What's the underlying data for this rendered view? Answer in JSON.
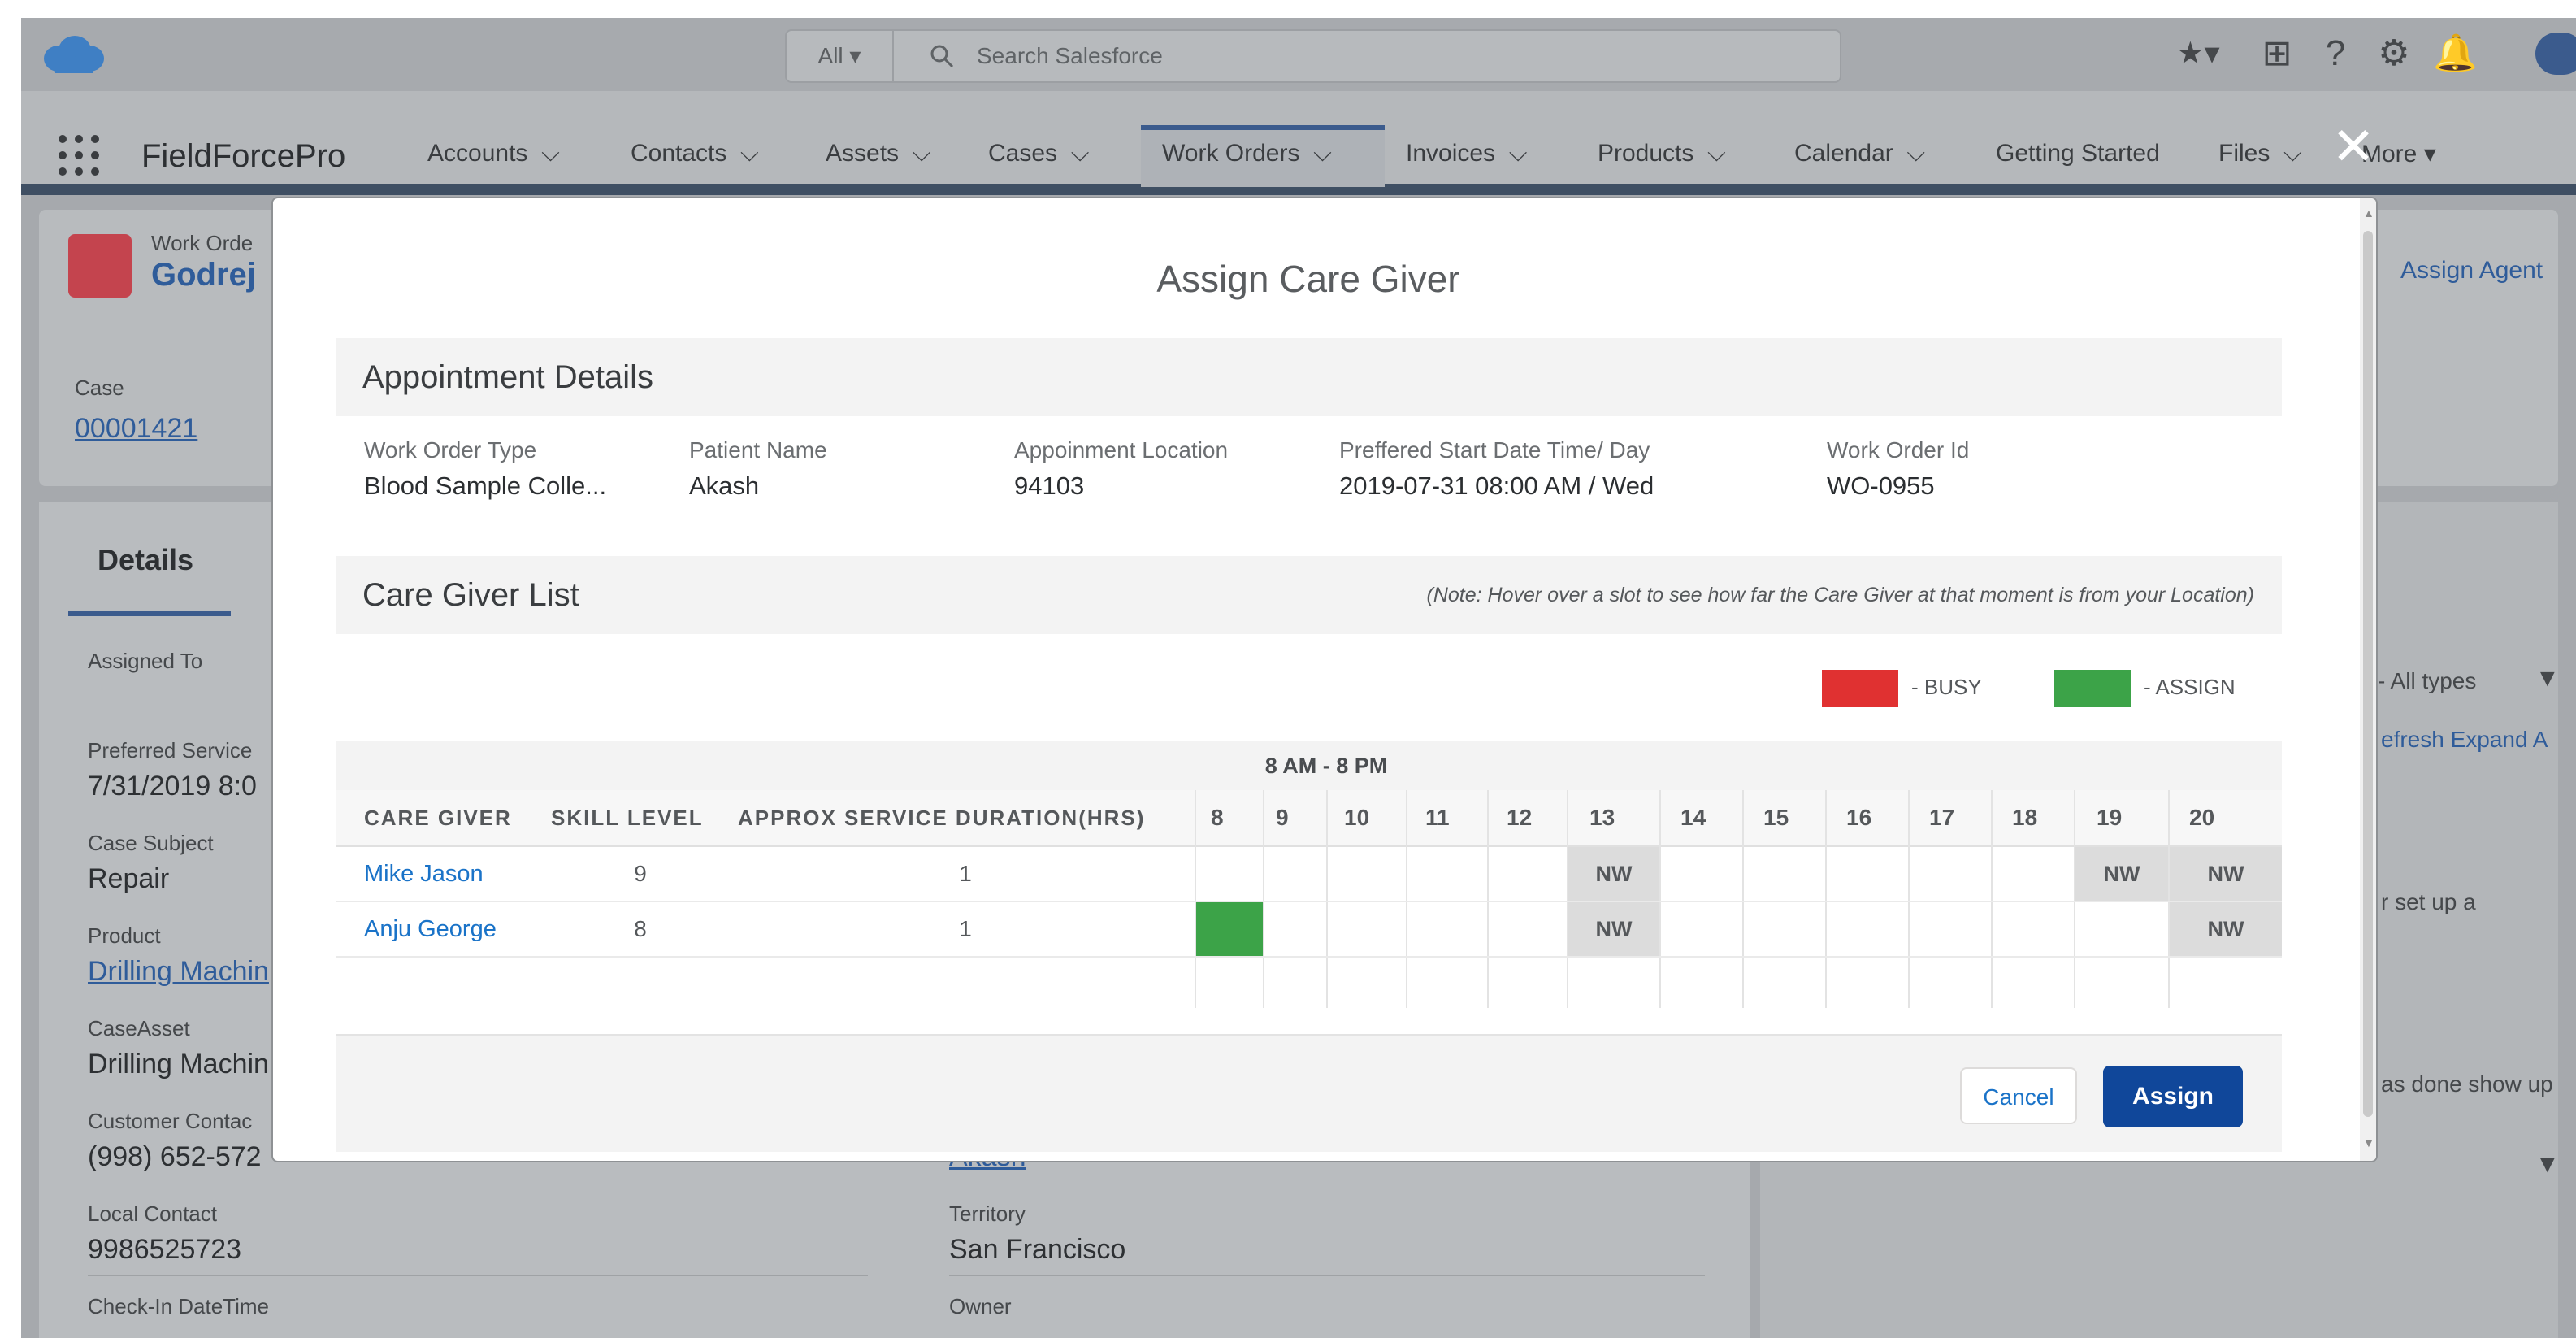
{
  "global_header": {
    "search_scope": "All",
    "search_placeholder": "Search Salesforce"
  },
  "nav": {
    "app_name": "FieldForcePro",
    "items": [
      "Accounts",
      "Contacts",
      "Assets",
      "Cases",
      "Work Orders",
      "Invoices",
      "Products",
      "Calendar",
      "Getting Started",
      "Files",
      "More"
    ],
    "active": "Work Orders"
  },
  "record": {
    "object_label": "Work Orde",
    "title": "Godrej",
    "case_label": "Case",
    "case_value": "00001421",
    "assign_agent": "Assign Agent"
  },
  "details_tab": "Details",
  "background_fields": [
    {
      "label": "Assigned To",
      "value": ""
    },
    {
      "label": "Preferred Service",
      "value": "7/31/2019 8:0"
    },
    {
      "label": "Case Subject",
      "value": "Repair"
    },
    {
      "label": "Product",
      "value": "Drilling Machin"
    },
    {
      "label": "CaseAsset",
      "value": "Drilling Machin"
    },
    {
      "label": "Customer Contac",
      "value": "(998) 652-572"
    },
    {
      "label": "Local Contact",
      "value": "9986525723"
    },
    {
      "label": "Check-In DateTime",
      "value": ""
    }
  ],
  "background_right_fields": [
    {
      "label": "",
      "value": "Akash"
    },
    {
      "label": "Territory",
      "value": "San Francisco"
    },
    {
      "label": "Owner",
      "value": ""
    }
  ],
  "activity_panel": {
    "filter": "- All types",
    "links": "efresh Expand A",
    "text1": "r set up a",
    "text2": "as done show up"
  },
  "modal": {
    "title": "Assign Care Giver",
    "appointment": {
      "section_title": "Appointment Details",
      "fields": [
        {
          "label": "Work Order Type",
          "value": "Blood Sample Colle..."
        },
        {
          "label": "Patient Name",
          "value": "Akash"
        },
        {
          "label": "Appoinment Location",
          "value": "94103"
        },
        {
          "label": "Preffered Start Date Time/ Day",
          "value": "2019-07-31 08:00 AM / Wed"
        },
        {
          "label": "Work Order Id",
          "value": "WO-0955"
        }
      ]
    },
    "care_giver_list": {
      "section_title": "Care Giver List",
      "note": "(Note: Hover over a slot to see how far the Care Giver at that moment is from your Location)",
      "legend": [
        {
          "label": "- BUSY",
          "color": "#e03131"
        },
        {
          "label": "- ASSIGN",
          "color": "#3ca348"
        }
      ],
      "time_band": "8 AM - 8 PM",
      "columns": [
        "CARE GIVER",
        "SKILL LEVEL",
        "APPROX SERVICE DURATION(HRS)"
      ],
      "hours": [
        "8",
        "9",
        "10",
        "11",
        "12",
        "13",
        "14",
        "15",
        "16",
        "17",
        "18",
        "19",
        "20"
      ],
      "rows": [
        {
          "name": "Mike Jason",
          "skill": "9",
          "duration": "1",
          "slots": [
            "",
            "",
            "",
            "",
            "",
            "NW",
            "",
            "",
            "",
            "",
            "",
            "NW",
            "NW"
          ]
        },
        {
          "name": "Anju George",
          "skill": "8",
          "duration": "1",
          "slots": [
            "ASSIGN",
            "",
            "",
            "",
            "",
            "NW",
            "",
            "",
            "",
            "",
            "",
            "",
            "NW"
          ]
        }
      ],
      "slot_nw_label": "NW"
    },
    "footer": {
      "cancel": "Cancel",
      "assign": "Assign"
    }
  },
  "colors": {
    "brand_blue": "#10479a",
    "link_blue": "#1a73c8",
    "busy": "#e03131",
    "assign": "#3ca348",
    "not_working": "#dcdcdc"
  }
}
